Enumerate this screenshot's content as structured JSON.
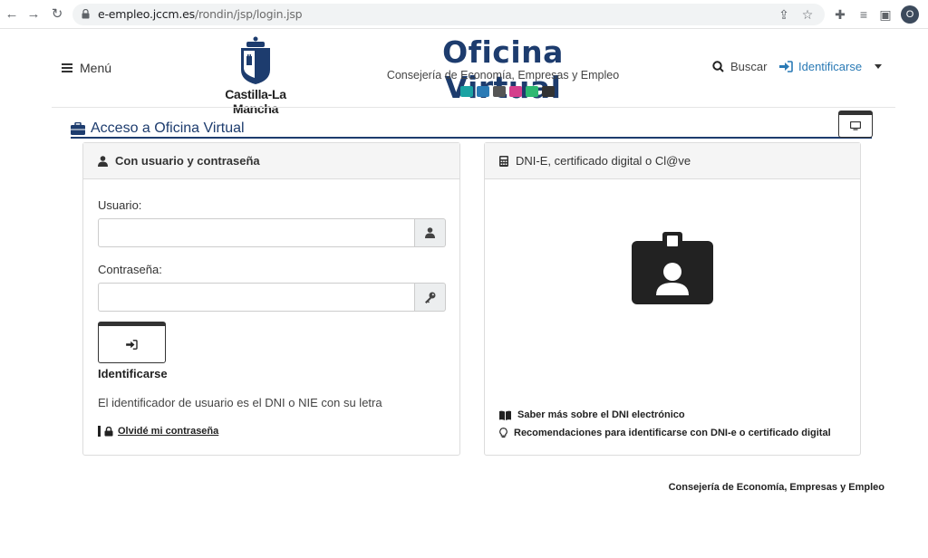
{
  "browser": {
    "url_host": "e-empleo.jccm.es",
    "url_path": "/rondin/jsp/login.jsp",
    "profile_initial": "O"
  },
  "header": {
    "menu_label": "Menú",
    "logo_text": "Castilla-La Mancha",
    "title": "Oficina Virtual",
    "subtitle": "Consejería de Economía, Empresas y Empleo",
    "search_label": "Buscar",
    "identify_label": "Identificarse"
  },
  "section": {
    "title": "Acceso a Oficina Virtual"
  },
  "login_panel": {
    "heading": "Con usuario y contraseña",
    "user_label": "Usuario:",
    "user_value": "",
    "password_label": "Contraseña:",
    "password_value": "",
    "submit_label": "Identificarse",
    "hint": "El identificador de usuario es el DNI o NIE con su letra",
    "forgot_label": "Olvidé mi contraseña"
  },
  "cert_panel": {
    "heading": "DNI-E, certificado digital o Cl@ve",
    "link_dni": "Saber más sobre el DNI electrónico",
    "link_recommendations": "Recomendaciones para identificarse con DNI-e o certificado digital"
  },
  "footer": {
    "text": "Consejería de Economía, Empresas y Empleo"
  },
  "colors": {
    "brand_blue": "#1d3c6e",
    "link_blue": "#2a7ab5",
    "icon_teal": "#1aa3a3",
    "icon_pink": "#d43f8d",
    "icon_green": "#2eb872"
  }
}
